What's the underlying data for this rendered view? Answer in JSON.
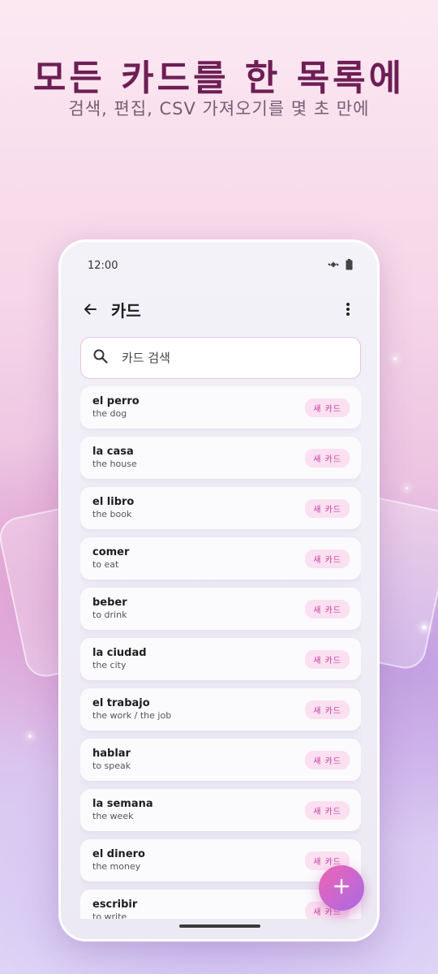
{
  "promo": {
    "headline": "모든 카드를 한 목록에",
    "subline": "검색, 편집, CSV 가져오기를 몇 초 만에"
  },
  "status_bar": {
    "time": "12:00"
  },
  "app_bar": {
    "title": "카드"
  },
  "search": {
    "placeholder": "카드 검색"
  },
  "cards": [
    {
      "term": "el perro",
      "meaning": "the dog",
      "badge": "새 카드"
    },
    {
      "term": "la casa",
      "meaning": "the house",
      "badge": "새 카드"
    },
    {
      "term": "el libro",
      "meaning": "the book",
      "badge": "새 카드"
    },
    {
      "term": "comer",
      "meaning": "to eat",
      "badge": "새 카드"
    },
    {
      "term": "beber",
      "meaning": "to drink",
      "badge": "새 카드"
    },
    {
      "term": "la ciudad",
      "meaning": "the city",
      "badge": "새 카드"
    },
    {
      "term": "el trabajo",
      "meaning": "the work / the job",
      "badge": "새 카드"
    },
    {
      "term": "hablar",
      "meaning": "to speak",
      "badge": "새 카드"
    },
    {
      "term": "la semana",
      "meaning": "the week",
      "badge": "새 카드"
    },
    {
      "term": "el dinero",
      "meaning": "the money",
      "badge": "새 카드"
    },
    {
      "term": "escribir",
      "meaning": "to write",
      "badge": "새 카드"
    }
  ],
  "icons": {
    "back": "arrow-left-icon",
    "menu": "more-vert-icon",
    "search": "search-icon",
    "fab": "plus-icon",
    "status": [
      "satellite-icon",
      "battery-icon"
    ]
  },
  "colors": {
    "headline": "#6e1e55",
    "badge_text": "#c2389c",
    "badge_bg": "#fbe0f1",
    "fab_start": "#f064b4",
    "fab_end": "#a86ae6"
  }
}
